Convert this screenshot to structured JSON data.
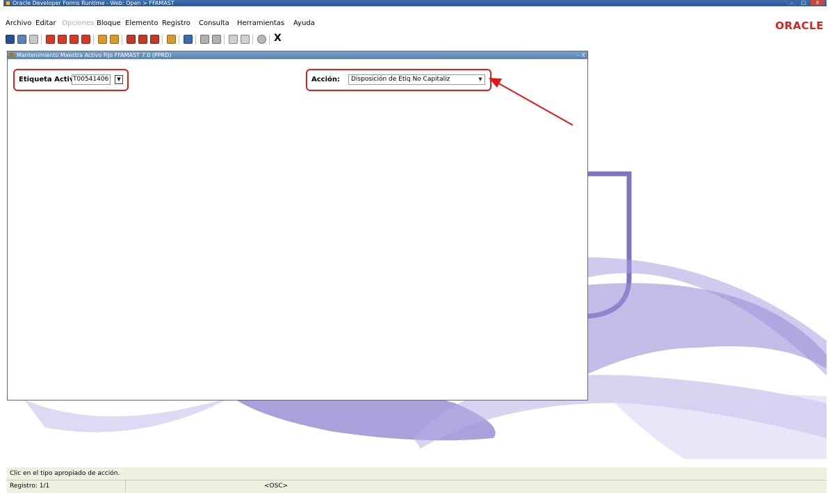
{
  "window": {
    "title": "Oracle Developer Forms Runtime - Web:  Open > FFAMAST",
    "controls": {
      "minimize": "–",
      "maximize": "□",
      "close": "X"
    }
  },
  "menubar": {
    "items": [
      {
        "label": "Archivo",
        "enabled": true
      },
      {
        "label": "Editar",
        "enabled": true
      },
      {
        "label": "Opciones",
        "enabled": false
      },
      {
        "label": "Bloque",
        "enabled": true
      },
      {
        "label": "Elemento",
        "enabled": true
      },
      {
        "label": "Registro",
        "enabled": true
      },
      {
        "label": "Consulta",
        "enabled": true
      },
      {
        "label": "Herramientas",
        "enabled": true
      },
      {
        "label": "Ayuda",
        "enabled": true
      }
    ],
    "logo": "ORACLE"
  },
  "toolbar": {
    "buttons": [
      {
        "icon": "save-icon",
        "color": "#2a4f9a"
      },
      {
        "icon": "undo-icon",
        "color": "#5e82b8"
      },
      {
        "icon": "print-icon",
        "color": "#c8c8c8"
      },
      {
        "icon": "previous-block-icon",
        "color": "#d43a2a"
      },
      {
        "icon": "previous-record-icon",
        "color": "#d43a2a"
      },
      {
        "icon": "next-record-icon",
        "color": "#d43a2a"
      },
      {
        "icon": "next-block-icon",
        "color": "#d43a2a"
      },
      {
        "icon": "enter-query-icon",
        "color": "#d89a2a"
      },
      {
        "icon": "execute-query-icon",
        "color": "#d89a2a"
      },
      {
        "icon": "insert-record-icon",
        "color": "#c03a2a"
      },
      {
        "icon": "duplicate-record-icon",
        "color": "#c03a2a"
      },
      {
        "icon": "delete-record-icon",
        "color": "#c03a2a"
      },
      {
        "icon": "lock-record-icon",
        "color": "#d89a2a"
      },
      {
        "icon": "print-report-icon",
        "color": "#3a6ab0"
      },
      {
        "icon": "clear-field-icon",
        "color": "#b0b0b0"
      },
      {
        "icon": "clear-block-icon",
        "color": "#b0b0b0"
      },
      {
        "icon": "disabled-tool-icon",
        "color": "#d0d0d0"
      },
      {
        "icon": "disabled-tool-icon",
        "color": "#d0d0d0"
      },
      {
        "icon": "help-icon",
        "color": "#b8b8b8"
      }
    ],
    "exit_label": "X"
  },
  "form": {
    "title": "Mantenimiento Maestra Activo Fijo  FFAMAST  7.0  (PPRD)",
    "title_controls": "–  X",
    "tag_label": "Etiqueta Activ",
    "tag_value": "T00541406",
    "lov_glyph": "▼",
    "action_label": "Acción:",
    "action_value": "Disposición de Etiq No Capitaliz",
    "action_dropdown_glyph": "▼"
  },
  "status": {
    "message": "Clic en el tipo apropiado de acción.",
    "record": "Registro: 1/1",
    "mode": "<OSC>"
  },
  "colors": {
    "highlight": "#d92020",
    "oracle_red": "#d6231f",
    "status_bg": "#eff0e2",
    "deco_purple": "#8073c0"
  }
}
